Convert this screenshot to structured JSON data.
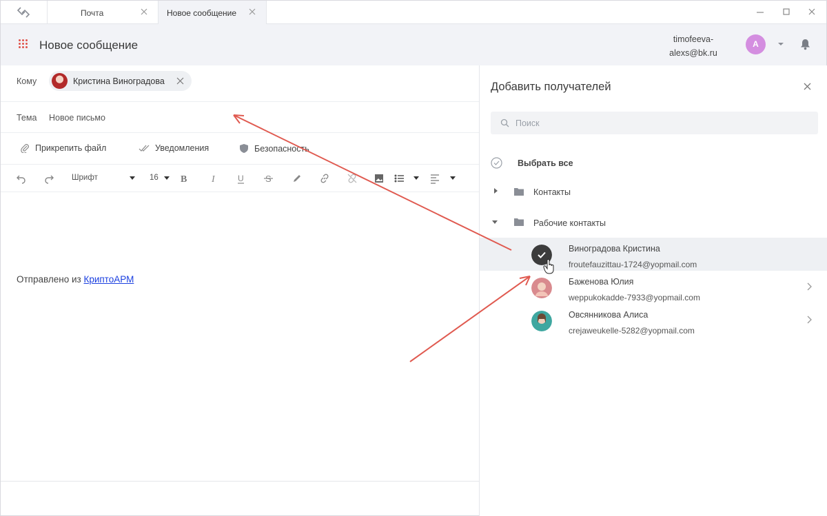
{
  "tabs": [
    {
      "label": "Почта"
    },
    {
      "label": "Новое сообщение"
    }
  ],
  "header": {
    "title": "Новое сообщение",
    "account_line1": "timofeeva-",
    "account_line2": "alexs@bk.ru",
    "avatar_letter": "A"
  },
  "compose": {
    "to_label": "Кому",
    "recipient": "Кристина Виноградова",
    "subject_label": "Тема",
    "subject_value": "Новое письмо",
    "attach_label": "Прикрепить файл",
    "notify_label": "Уведомления",
    "security_label": "Безопасность",
    "font_label": "Шрифт",
    "font_size": "16",
    "signature_prefix": "Отправлено из ",
    "signature_link": "КриптоАРМ"
  },
  "panel": {
    "title": "Добавить получателей",
    "search_placeholder": "Поиск",
    "select_all": "Выбрать все",
    "folders": [
      {
        "label": "Контакты",
        "expanded": false
      },
      {
        "label": "Рабочие контакты",
        "expanded": true
      }
    ],
    "contacts": [
      {
        "name": "Виноградова Кристина",
        "email": "froutefauzittau-1724@yopmail.com",
        "selected": true
      },
      {
        "name": "Баженова Юлия",
        "email": "weppukokadde-7933@yopmail.com",
        "selected": false
      },
      {
        "name": "Овсянникова Алиса",
        "email": "crejaweukelle-5282@yopmail.com",
        "selected": false
      }
    ]
  },
  "colors": {
    "accent_red": "#e0544c",
    "avatar": "#d48ee0",
    "link": "#1a3fe0",
    "selected_row": "#eef0f3",
    "header_bg": "#f2f3f7"
  }
}
